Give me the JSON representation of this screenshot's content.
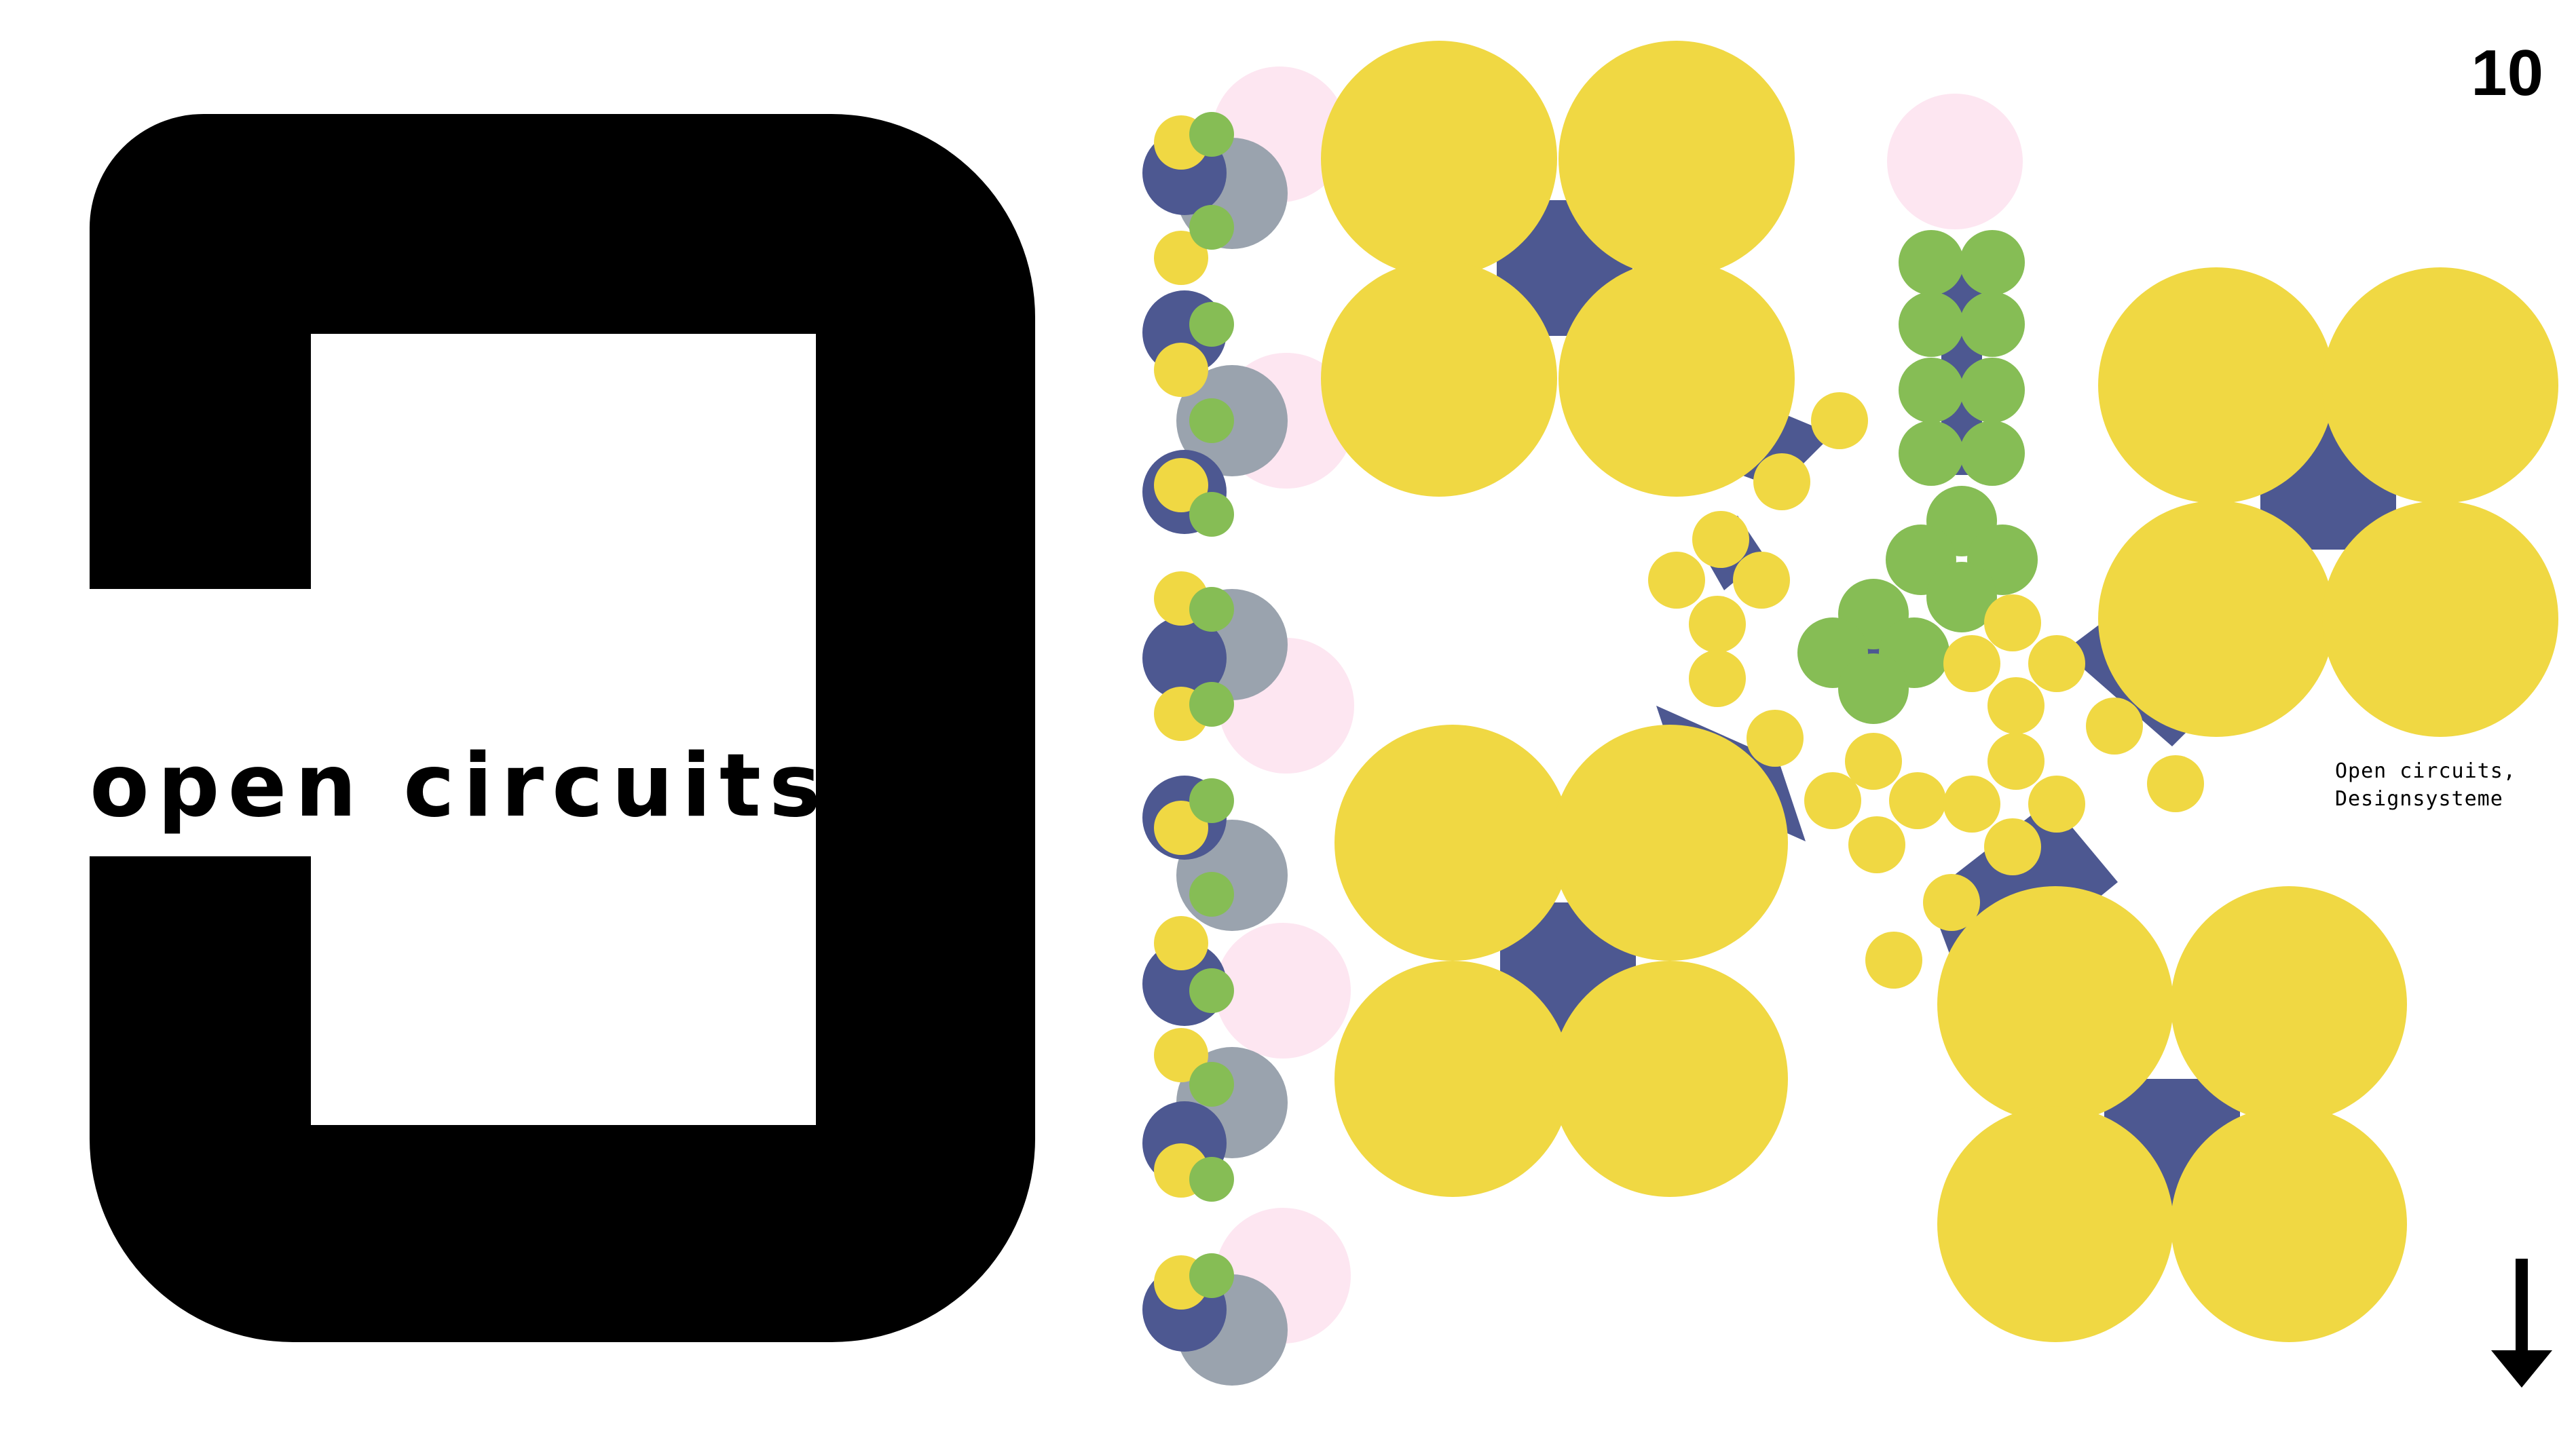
{
  "slide": {
    "page_number": "10",
    "title": "open circuits",
    "caption_lines": [
      "Open circuits,",
      "Designsysteme"
    ]
  },
  "colors": {
    "yellow": "#f0d843",
    "navy": "#4d5891",
    "green": "#86bd55",
    "pink": "#fde6f1",
    "grey": "#9aa3ae",
    "logo": "#000000"
  },
  "icons": {
    "logo_mark": "open-circuits-logo",
    "arrow": "arrow-down-icon"
  }
}
